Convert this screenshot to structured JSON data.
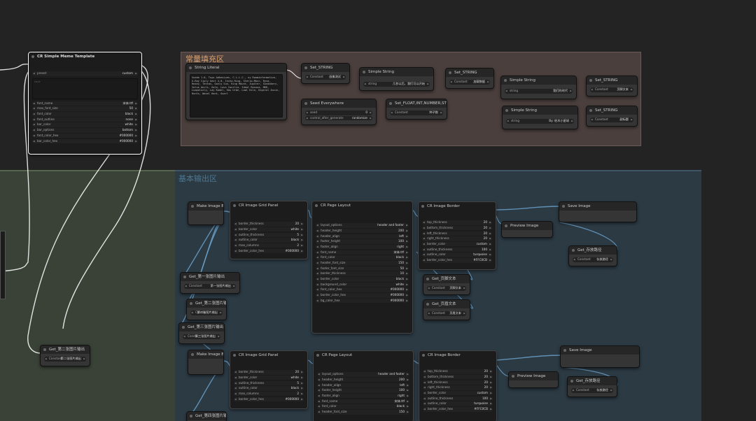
{
  "groups": {
    "top": "常量填充区",
    "main": "基本输出区"
  },
  "memo": {
    "title": "CR Simple Meme Template",
    "preset": {
      "label": "preset",
      "value": "custom"
    },
    "textarea_placeholder": "text",
    "widgets": [
      {
        "label": "font_name",
        "value": "宋体.ttf"
      },
      {
        "label": "max_font_size",
        "value": "50"
      },
      {
        "label": "font_color",
        "value": "black"
      },
      {
        "label": "font_outline",
        "value": "none"
      },
      {
        "label": "bar_color",
        "value": "white"
      },
      {
        "label": "bar_options",
        "value": "bottom"
      },
      {
        "label": "font_color_hex",
        "value": "#000000"
      },
      {
        "label": "bar_color_hex",
        "value": "#000000"
      }
    ]
  },
  "string_literal": {
    "title": "String Literal",
    "text": "Suede 1.0, Toyo Adhesives, C.L.L.C., ny Roominformative, X-Ray Ciply kest 4.0, Incha-Ring, Sterio-Mocc, Ryva, Hosey, Tentas, Gonly Sun, Ring Mount, Jupiter, Sundakery, Iolus Ancli, Gale, Lavs Ionilia, Ideal Rosuna, MKR, Luapoluzly, Lay Kadel, Emu Urbe, Laal Kile, Digital Ancin, Hunts, Wasel Hant, Guarl"
  },
  "set_string_1": {
    "title": "Set_STRING",
    "label": "Constant",
    "value": "画像测试"
  },
  "simple_string_1": {
    "title": "Simple String",
    "label": "string",
    "value": "几秒以后，我们可以开始"
  },
  "set_string_2": {
    "title": "Set_STRING",
    "label": "Constant",
    "value": "加载数据"
  },
  "simple_string_2": {
    "title": "Simple String",
    "label": "string",
    "value": "我们的时代"
  },
  "set_string_3": {
    "title": "Set_STRING",
    "label": "Constant",
    "value": "副标题"
  },
  "seed": {
    "title": "Seed Everywhere",
    "seed_label": "seed",
    "seed_value": "0",
    "cag_label": "control_after_generate",
    "cag_value": "randomize"
  },
  "set_float": {
    "title": "Set_FLOAT,INT,NUMBER,STRING",
    "label": "Constant",
    "value": "种子数"
  },
  "simple_string_3": {
    "title": "Simple String",
    "label": "string",
    "value": "By: 枯木小星球"
  },
  "set_string_4": {
    "title": "Set_STRING",
    "label": "Constant",
    "value": "页脚文本"
  },
  "row1": {
    "batch": "Make Image Batch",
    "get1": {
      "title": "Get_第一张图片输出",
      "label": "Constant",
      "value": "第一张图片输出"
    },
    "get2": {
      "title": "Get_第二张图片输出",
      "label": "Consta",
      "value": "第二张图片输出"
    },
    "get3": {
      "title": "Get_第三张图片输出",
      "label": "Consta",
      "value": "第三张图片输出"
    },
    "grid": {
      "title": "CR Image Grid Panel",
      "widgets": [
        {
          "label": "border_thickness",
          "value": "20"
        },
        {
          "label": "border_color",
          "value": "white"
        },
        {
          "label": "outline_thickness",
          "value": "5"
        },
        {
          "label": "outline_color",
          "value": "black"
        },
        {
          "label": "max_columns",
          "value": "2"
        },
        {
          "label": "border_color_hex",
          "value": "#000000"
        }
      ]
    },
    "layout": {
      "title": "CR Page Layout",
      "widgets": [
        {
          "label": "layout_options",
          "value": "header and footer"
        },
        {
          "label": "header_height",
          "value": "200"
        },
        {
          "label": "header_align",
          "value": "left"
        },
        {
          "label": "footer_height",
          "value": "100"
        },
        {
          "label": "footer_align",
          "value": "right"
        },
        {
          "label": "font_name",
          "value": "宋体.ttf"
        },
        {
          "label": "font_color",
          "value": "black"
        },
        {
          "label": "header_font_size",
          "value": "150"
        },
        {
          "label": "footer_font_size",
          "value": "50"
        },
        {
          "label": "border_thickness",
          "value": "10"
        },
        {
          "label": "border_color",
          "value": "black"
        },
        {
          "label": "background_color",
          "value": "white"
        },
        {
          "label": "font_color_hex",
          "value": "#000000"
        },
        {
          "label": "border_color_hex",
          "value": "#000000"
        },
        {
          "label": "bg_color_hex",
          "value": "#000000"
        }
      ]
    },
    "border": {
      "title": "CR Image Border",
      "widgets": [
        {
          "label": "top_thickness",
          "value": "20"
        },
        {
          "label": "bottom_thickness",
          "value": "20"
        },
        {
          "label": "left_thickness",
          "value": "20"
        },
        {
          "label": "right_thickness",
          "value": "20"
        },
        {
          "label": "border_color",
          "value": "custom"
        },
        {
          "label": "outline_thickness",
          "value": "100"
        },
        {
          "label": "outline_color",
          "value": "turquoise"
        },
        {
          "label": "border_color_hex",
          "value": "#FFC0CB"
        }
      ]
    },
    "preview": "Preview Image",
    "save": "Save Image",
    "get_footer": {
      "title": "Get_页脚文本",
      "label": "Constant",
      "value": "页脚文本"
    },
    "get_sub": {
      "title": "Get_页眉文本",
      "label": "Constant",
      "value": "页眉文本"
    },
    "get_save": {
      "title": "Get_存放路径",
      "label": "Constant",
      "value": "存放路径"
    }
  },
  "left": {
    "get2": {
      "title": "Get_第二张图片输出",
      "label": "Constant",
      "value": "第二张图片输出"
    }
  },
  "row2": {
    "batch": "Make Image Batch",
    "grid": {
      "title": "CR Image Grid Panel",
      "widgets": [
        {
          "label": "border_thickness",
          "value": "20"
        },
        {
          "label": "border_color",
          "value": "white"
        },
        {
          "label": "outline_thickness",
          "value": "5"
        },
        {
          "label": "outline_color",
          "value": "black"
        },
        {
          "label": "max_columns",
          "value": "2"
        },
        {
          "label": "border_color_hex",
          "value": "#000000"
        }
      ]
    },
    "layout": {
      "title": "CR Page Layout",
      "widgets": [
        {
          "label": "layout_options",
          "value": "header and footer"
        },
        {
          "label": "header_height",
          "value": "200"
        },
        {
          "label": "header_align",
          "value": "left"
        },
        {
          "label": "footer_height",
          "value": "100"
        },
        {
          "label": "footer_align",
          "value": "right"
        },
        {
          "label": "font_name",
          "value": "宋体.ttf"
        },
        {
          "label": "font_color",
          "value": "black"
        },
        {
          "label": "header_font_size",
          "value": "150"
        }
      ]
    },
    "border": {
      "title": "CR Image Border",
      "widgets": [
        {
          "label": "top_thickness",
          "value": "20"
        },
        {
          "label": "bottom_thickness",
          "value": "20"
        },
        {
          "label": "left_thickness",
          "value": "20"
        },
        {
          "label": "right_thickness",
          "value": "20"
        },
        {
          "label": "border_color",
          "value": "custom"
        },
        {
          "label": "outline_thickness",
          "value": "100"
        },
        {
          "label": "outline_color",
          "value": "turquoise"
        },
        {
          "label": "border_color_hex",
          "value": "#FFC0CB"
        }
      ]
    },
    "preview": "Preview Image",
    "save": "Save Image",
    "get_save": {
      "title": "Get_存放路径",
      "label": "Constant",
      "value": "存放路径"
    },
    "get4": {
      "title": "Get_第四张图片输出"
    }
  }
}
